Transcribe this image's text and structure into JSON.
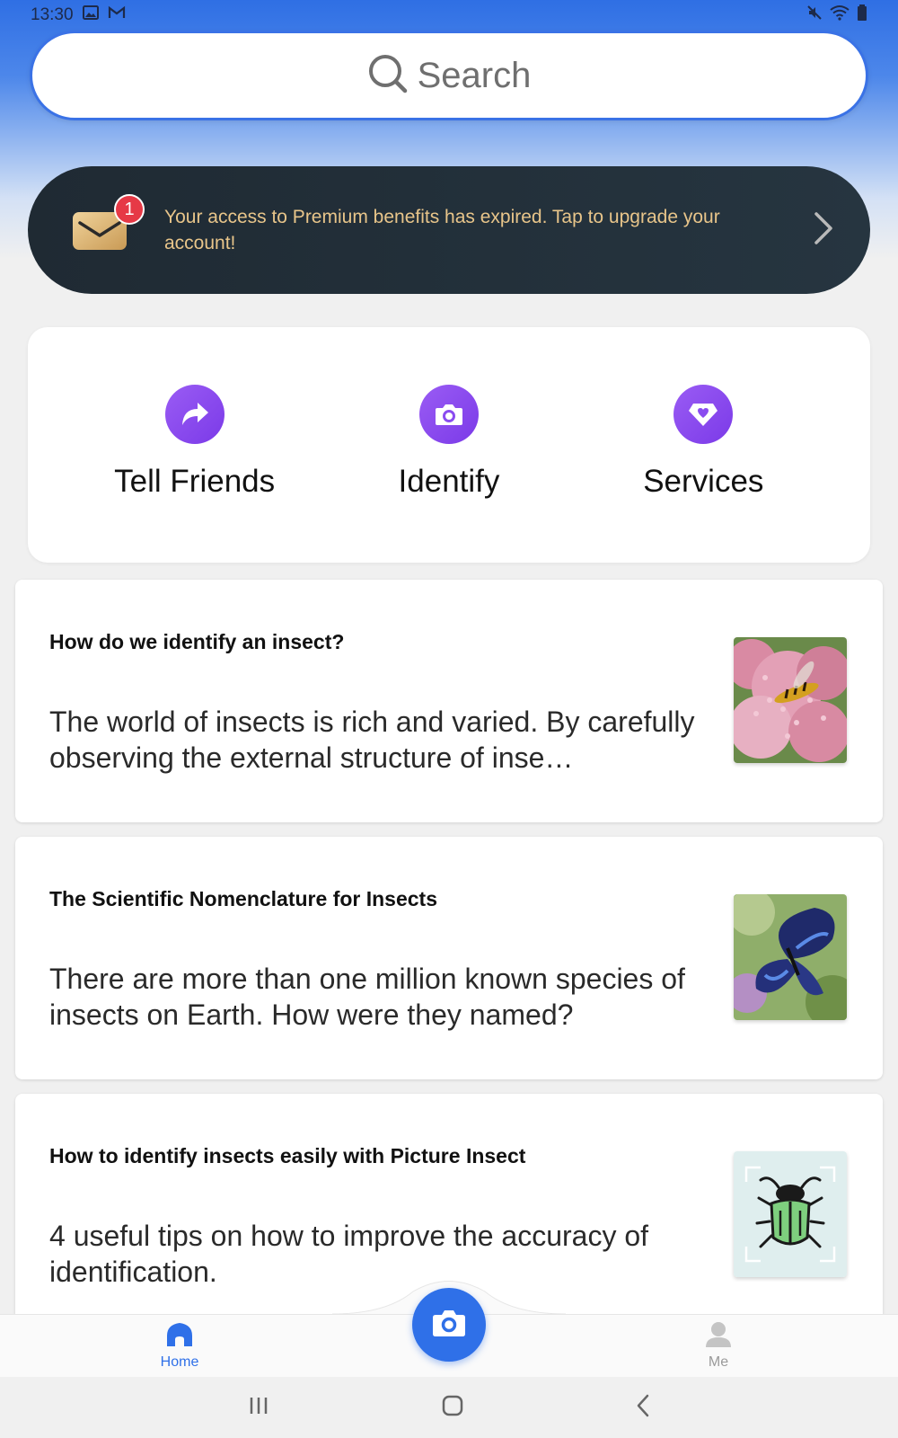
{
  "status_bar": {
    "time": "13:30"
  },
  "search": {
    "placeholder": "Search"
  },
  "premium_banner": {
    "badge_count": "1",
    "message": "Your access to Premium benefits has expired. Tap to upgrade your account!"
  },
  "quick_actions": [
    {
      "label": "Tell Friends",
      "icon": "share-arrow-icon"
    },
    {
      "label": "Identify",
      "icon": "camera-icon"
    },
    {
      "label": "Services",
      "icon": "diamond-heart-icon"
    }
  ],
  "articles": [
    {
      "title": "How do we identify an insect?",
      "description": "The world of insects is rich and varied. By carefully observing the external structure of inse…",
      "thumbnail": "wasp-on-flowers"
    },
    {
      "title": "The Scientific Nomenclature for Insects",
      "description": "There are more than one million known species of insects on Earth. How were they named?",
      "thumbnail": "blue-butterfly"
    },
    {
      "title": "How to identify insects easily with Picture Insect",
      "description": "4 useful tips on how to improve the accuracy of identification.",
      "thumbnail": "beetle-scan-illustration"
    }
  ],
  "bottom_nav": {
    "home_label": "Home",
    "me_label": "Me",
    "active": "Home"
  },
  "colors": {
    "primary_blue": "#2f70e8",
    "accent_purple": "#8a4cf0",
    "banner_text_gold": "#e8c58a",
    "banner_bg": "#1f2a33",
    "badge_red": "#e63946"
  }
}
